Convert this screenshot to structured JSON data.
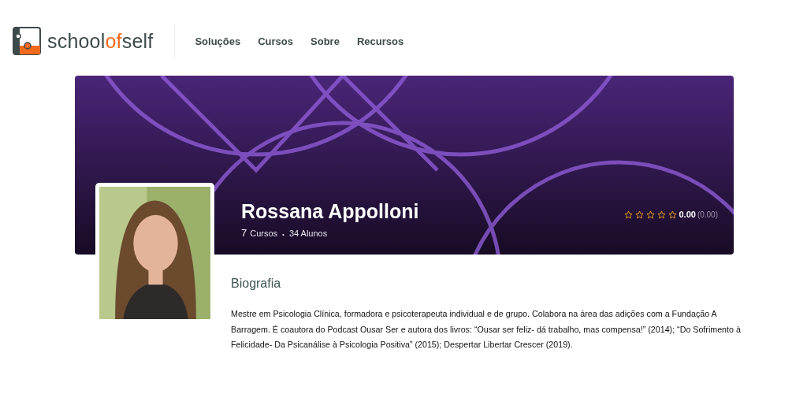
{
  "logo": {
    "parts": [
      {
        "text": "school",
        "accent": false
      },
      {
        "text": "of",
        "accent": true
      },
      {
        "text": "self",
        "accent": false
      }
    ]
  },
  "nav": [
    "Soluções",
    "Cursos",
    "Sobre",
    "Recursos"
  ],
  "profile": {
    "name": "Rossana Appolloni",
    "courses_count": "7",
    "courses_label": "Cursos",
    "separator": "•",
    "students": "34 Alunos",
    "stars": 0,
    "rating": "0.00",
    "rating_note": "(0.00)"
  },
  "bio": {
    "heading": "Biografia",
    "text": "Mestre em Psicologia Clínica, formadora e psicoterapeuta individual e de grupo. Colabora na área das adições com a Fundação A Barragem. É coautora do Podcast Ousar Ser e autora dos livros: “Ousar ser feliz- dá trabalho, mas compensa!” (2014); “Do Sofrimento à Felicidade- Da Psicanálise à Psicologia Positiva” (2015); Despertar Libertar Crescer (2019)."
  }
}
